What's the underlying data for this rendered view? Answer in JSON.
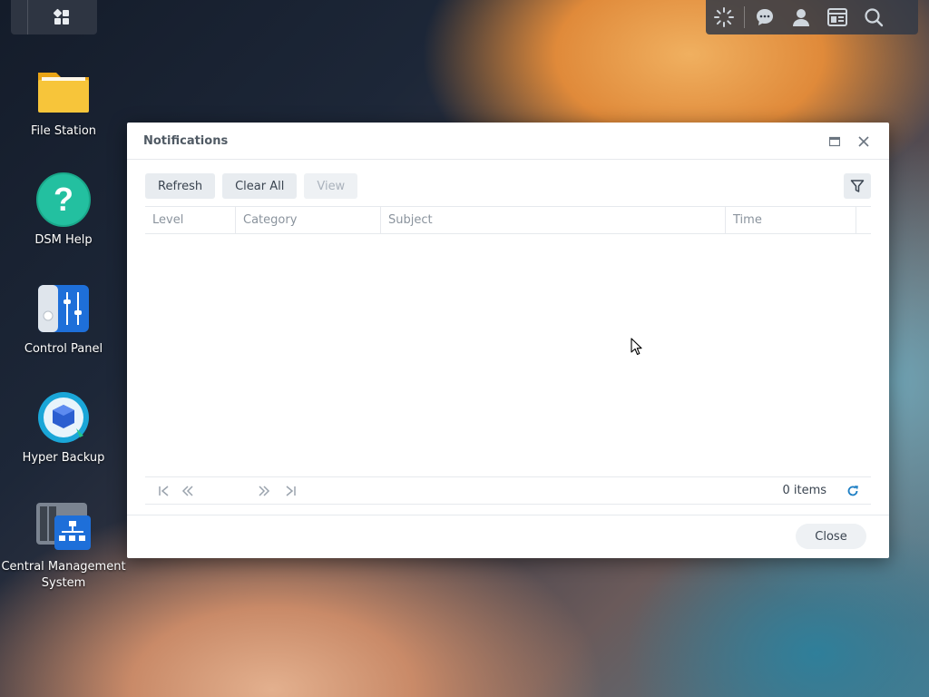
{
  "taskbar": {
    "main_menu_icon": "grid-icon",
    "right_icons": [
      "loading-spinner-icon",
      "chat-icon",
      "user-icon",
      "widgets-icon",
      "search-icon"
    ]
  },
  "desktop": {
    "icons": [
      {
        "label": "File Station",
        "icon": "folder-icon"
      },
      {
        "label": "DSM Help",
        "icon": "help-icon"
      },
      {
        "label": "Control Panel",
        "icon": "control-panel-icon"
      },
      {
        "label": "Hyper Backup",
        "icon": "hyper-backup-icon"
      },
      {
        "label": "Central Management System",
        "icon": "cms-icon"
      }
    ]
  },
  "window": {
    "title": "Notifications",
    "toolbar": {
      "refresh": "Refresh",
      "clear_all": "Clear All",
      "view": "View"
    },
    "columns": [
      "Level",
      "Category",
      "Subject",
      "Time"
    ],
    "rows": [],
    "pager": {
      "count_text": "0 items"
    },
    "close_label": "Close"
  },
  "colors": {
    "accent": "#1e7fc4",
    "window_bg": "#ffffff",
    "taskbar_bg": "#323a46"
  }
}
